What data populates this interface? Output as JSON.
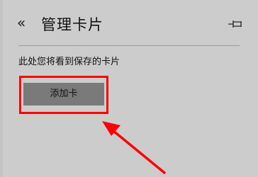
{
  "header": {
    "back_glyph": "«",
    "title": "管理卡片"
  },
  "main": {
    "subtitle": "此处您将看到保存的卡片",
    "add_card_label": "添加卡"
  },
  "colors": {
    "background": "#cccccc",
    "button_bg": "#7a7a7a",
    "highlight": "#ff0000",
    "text": "#111111"
  }
}
